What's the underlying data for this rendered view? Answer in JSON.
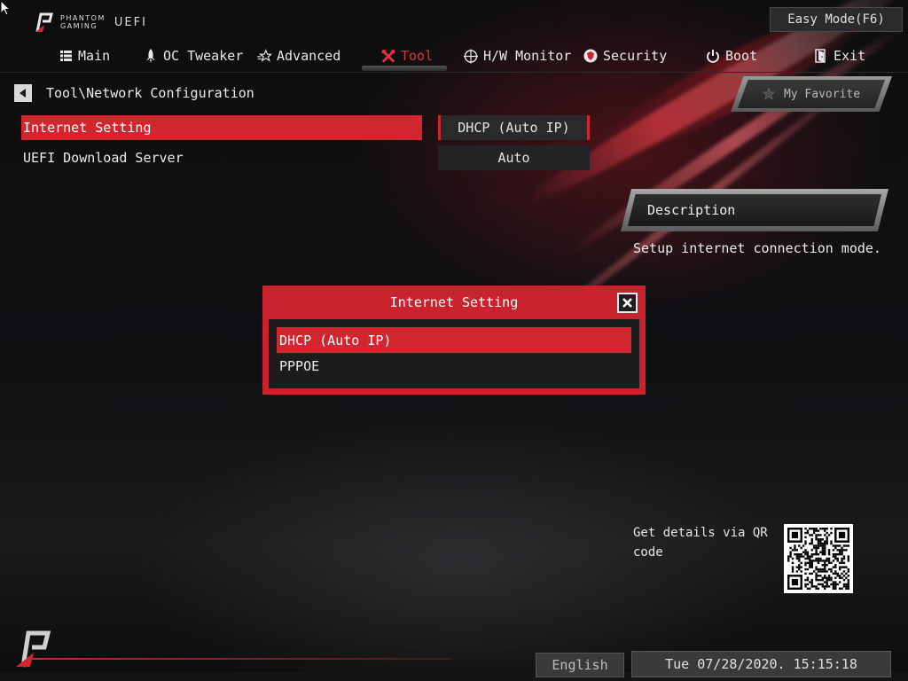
{
  "brand": {
    "line1": "PHANTOM",
    "line2": "GAMING",
    "product": "UEFI"
  },
  "header": {
    "easy_mode_label": "Easy Mode(F6)"
  },
  "tabs": [
    {
      "label": "Main",
      "icon": "list-icon",
      "active": false
    },
    {
      "label": "OC Tweaker",
      "icon": "rocket-icon",
      "active": false
    },
    {
      "label": "Advanced",
      "icon": "star-icon",
      "active": false
    },
    {
      "label": "Tool",
      "icon": "tools-icon",
      "active": true
    },
    {
      "label": "H/W Monitor",
      "icon": "crosshair-icon",
      "active": false
    },
    {
      "label": "Security",
      "icon": "shield-icon",
      "active": false
    },
    {
      "label": "Boot",
      "icon": "power-icon",
      "active": false
    },
    {
      "label": "Exit",
      "icon": "exit-door-icon",
      "active": false
    }
  ],
  "breadcrumb": {
    "path": "Tool\\Network Configuration"
  },
  "settings": [
    {
      "label": "Internet Setting",
      "value": "DHCP (Auto IP)",
      "selected": true
    },
    {
      "label": "UEFI Download Server",
      "value": "Auto",
      "selected": false
    }
  ],
  "favorite": {
    "label": "My Favorite"
  },
  "description": {
    "header": "Description",
    "text": "Setup internet connection mode."
  },
  "modal": {
    "title": "Internet Setting",
    "options": [
      {
        "label": "DHCP (Auto IP)",
        "selected": true
      },
      {
        "label": "PPPOE",
        "selected": false
      }
    ]
  },
  "qr": {
    "text": "Get details via QR code"
  },
  "footer": {
    "language": "English",
    "datetime": "Tue 07/28/2020. 15:15:18"
  },
  "colors": {
    "accent": "#d2262f",
    "background": "#0b0b0d"
  }
}
